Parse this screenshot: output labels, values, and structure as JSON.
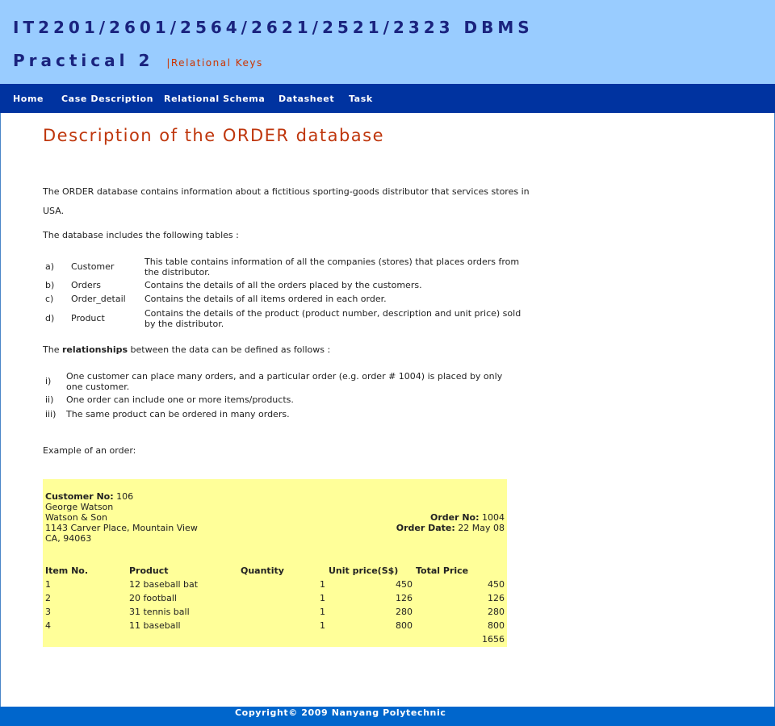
{
  "header": {
    "title": "IT2201/2601/2564/2621/2521/2323 DBMS",
    "subtitle": "Practical 2",
    "subtitle_tag": "|Relational Keys"
  },
  "nav": {
    "items": [
      {
        "label": "Home"
      },
      {
        "label": "Case Description"
      },
      {
        "label": "Relational Schema"
      },
      {
        "label": "Datasheet"
      },
      {
        "label": "Task"
      }
    ]
  },
  "main": {
    "heading": "Description of the ORDER database",
    "intro": "The ORDER database contains information about a fictitious sporting-goods distributor that services stores in USA.",
    "tables_intro": "The database includes the following tables :",
    "tables": [
      {
        "key": "a)",
        "name": "Customer",
        "desc": "This table contains information of all the companies (stores) that places orders from the distributor."
      },
      {
        "key": "b)",
        "name": "Orders",
        "desc": "Contains the details of all the orders placed by the customers."
      },
      {
        "key": "c)",
        "name": "Order_detail",
        "desc": "Contains the details of all items ordered in each order."
      },
      {
        "key": "d)",
        "name": "Product",
        "desc": "Contains the details of the product (product number, description and unit price) sold by the distributor."
      }
    ],
    "rel_prefix": "The ",
    "rel_bold": "relationships",
    "rel_suffix": " between the data can be defined as follows :",
    "relationships": [
      {
        "key": "i)",
        "desc": "One customer can place many orders, and a particular order (e.g. order # 1004) is placed by only one customer."
      },
      {
        "key": "ii)",
        "desc": "One order can include one or more items/products."
      },
      {
        "key": "iii)",
        "desc": "The same product can be ordered in many orders."
      }
    ],
    "example_label": "Example of an order:"
  },
  "order": {
    "customer_no_label": "Customer No:",
    "customer_no": "106",
    "name": "George Watson",
    "company": "Watson & Son",
    "address1": "1143 Carver Place, Mountain View",
    "address2": "CA, 94063",
    "order_no_label": "Order No:",
    "order_no": "1004",
    "order_date_label": "Order Date:",
    "order_date": "22 May 08",
    "columns": [
      "Item No.",
      "Product",
      "Quantity",
      "Unit price(S$)",
      "Total Price"
    ],
    "rows": [
      {
        "item": "1",
        "product": "12 baseball bat",
        "qty": "1",
        "unit": "450",
        "total": "450"
      },
      {
        "item": "2",
        "product": "20 football",
        "qty": "1",
        "unit": "126",
        "total": "126"
      },
      {
        "item": "3",
        "product": "31 tennis ball",
        "qty": "1",
        "unit": "280",
        "total": "280"
      },
      {
        "item": "4",
        "product": "11 baseball",
        "qty": "1",
        "unit": "800",
        "total": "800"
      }
    ],
    "grand_total": "1656"
  },
  "footer": {
    "copyright": "Copyright© 2009 Nanyang Polytechnic"
  },
  "colors": {
    "header_bg": "#99ccff",
    "nav_bg": "#0033a0",
    "heading": "#bf360c",
    "order_bg": "#ffff99",
    "footer_bg": "#0066cc"
  }
}
